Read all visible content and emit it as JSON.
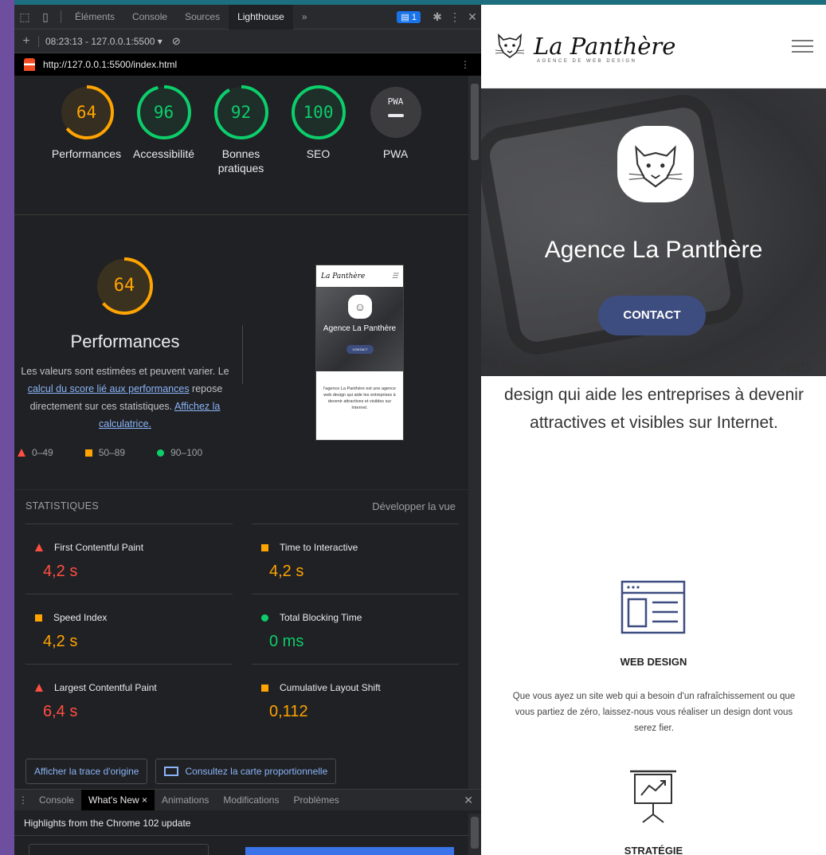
{
  "devtools": {
    "tabs": [
      "Éléments",
      "Console",
      "Sources",
      "Lighthouse",
      "»"
    ],
    "active_tab": "Lighthouse",
    "issues_badge": "1",
    "session": "08:23:13 - 127.0.0.1:5500 ▾",
    "url": "http://127.0.0.1:5500/index.html"
  },
  "lighthouse": {
    "gauges": [
      {
        "score": "64",
        "label": "Performances",
        "color": "#ffa400",
        "fraction": 0.64
      },
      {
        "score": "96",
        "label": "Accessibilité",
        "color": "#0cce6b",
        "fraction": 0.96
      },
      {
        "score": "92",
        "label": "Bonnes pratiques",
        "color": "#0cce6b",
        "fraction": 0.92
      },
      {
        "score": "100",
        "label": "SEO",
        "color": "#0cce6b",
        "fraction": 1.0
      },
      {
        "score": "PWA",
        "label": "PWA",
        "color": "#9aa0a6",
        "fraction": 0
      }
    ],
    "perf": {
      "score": "64",
      "title": "Performances",
      "desc_prefix": "Les valeurs sont estimées et peuvent varier. Le ",
      "link1": "calcul du score lié aux performances",
      "desc_mid": " repose directement sur ces statistiques. ",
      "link2": "Affichez la calculatrice."
    },
    "legend": [
      "0–49",
      "50–89",
      "90–100"
    ],
    "stats_title": "STATISTIQUES",
    "expand": "Développer la vue",
    "metrics": [
      {
        "name": "First Contentful Paint",
        "value": "4,2 s",
        "status": "red"
      },
      {
        "name": "Time to Interactive",
        "value": "4,2 s",
        "status": "orange"
      },
      {
        "name": "Speed Index",
        "value": "4,2 s",
        "status": "orange"
      },
      {
        "name": "Total Blocking Time",
        "value": "0 ms",
        "status": "green"
      },
      {
        "name": "Largest Contentful Paint",
        "value": "6,4 s",
        "status": "red"
      },
      {
        "name": "Cumulative Layout Shift",
        "value": "0,112",
        "status": "orange"
      }
    ],
    "buttons": [
      "Afficher la trace d'origine",
      "Consultez la carte proportionnelle"
    ],
    "thumbnail": {
      "brand": "La Panthère",
      "title": "Agence La Panthère",
      "cta": "CONTACT",
      "text": "l'agence La Panthère est une agence web design qui aide les entreprises à devenir attractives et visibles sur Internet."
    }
  },
  "drawer": {
    "tabs": [
      "Console",
      "What's New",
      "Animations",
      "Modifications",
      "Problèmes"
    ],
    "active": "What's New",
    "highlight": "Highlights from the Chrome 102 update"
  },
  "site": {
    "brand": "La Panthère",
    "tagline": "AGENCE DE WEB DESIGN",
    "hero_title": "Agence La Panthère",
    "cta": "CONTACT",
    "intro": "l'agence La Panthère est une agence web design qui aide les entreprises à devenir attractives et visibles sur Internet.",
    "services": [
      {
        "title": "WEB DESIGN",
        "desc": "Que vous ayez un site web qui a besoin d'un rafraîchissement ou que vous partiez de zéro, laissez-nous vous réaliser un design dont vous serez fier.",
        "icon": "web-design-icon"
      },
      {
        "title": "STRATÉGIE",
        "desc": "",
        "icon": "strategy-icon"
      }
    ]
  }
}
